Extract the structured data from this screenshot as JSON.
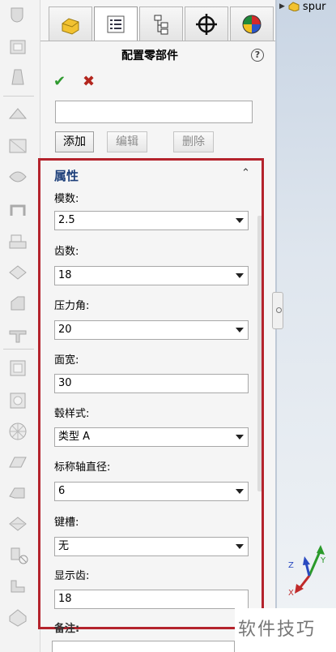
{
  "panel": {
    "title": "配置零部件",
    "help_label": "?",
    "ok_symbol": "✔",
    "cancel_symbol": "✖",
    "tabs": [
      "feature-manager",
      "property-manager",
      "configuration-manager",
      "dimxpert-manager",
      "display-manager"
    ]
  },
  "buttons": {
    "add": "添加",
    "edit": "编辑",
    "delete": "删除"
  },
  "properties": {
    "group_title": "属性",
    "collapse_symbol": "⌃",
    "module_label": "模数:",
    "module_value": "2.5",
    "teeth_label": "齿数:",
    "teeth_value": "18",
    "pressure_angle_label": "压力角:",
    "pressure_angle_value": "20",
    "face_width_label": "面宽:",
    "face_width_value": "30",
    "hub_style_label": "毂样式:",
    "hub_style_value": "类型 A",
    "nominal_shaft_label": "标称轴直径:",
    "nominal_shaft_value": "6",
    "keyway_label": "键槽:",
    "keyway_value": "无",
    "show_teeth_label": "显示齿:",
    "show_teeth_value": "18",
    "notes_label": "备注:"
  },
  "tree": {
    "item_label": "spur"
  },
  "watermark": "软件技巧",
  "colors": {
    "highlight": "#b4232c",
    "ok": "#2f9a2f",
    "cancel": "#b3261e",
    "group_title": "#1d3f7a"
  }
}
